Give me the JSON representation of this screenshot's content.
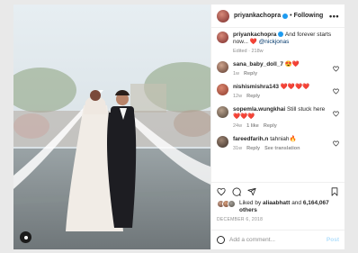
{
  "header": {
    "username": "priyankachopra",
    "separator": "•",
    "follow_label": "Following",
    "more_icon": "more-horizontal-icon",
    "more_glyph": "•••"
  },
  "caption": {
    "username": "priyankachopra",
    "text": "And forever starts now... ❤️",
    "mention": "@nickjonas",
    "edited": "Edited · 218w"
  },
  "comments": [
    {
      "username": "sana_baby_doll_7",
      "text": "😍❤️",
      "age": "1w",
      "likes": "",
      "reply": "Reply",
      "translate": ""
    },
    {
      "username": "nishismishra143",
      "text": "❤️❤️❤️❤️",
      "age": "12w",
      "likes": "",
      "reply": "Reply",
      "translate": ""
    },
    {
      "username": "sopemla.wungkhai",
      "text": "Still stuck here ❤️❤️❤️",
      "age": "24w",
      "likes": "1 like",
      "reply": "Reply",
      "translate": ""
    },
    {
      "username": "fareedfarih.n",
      "text": "tahniah🔥",
      "age": "31w",
      "likes": "",
      "reply": "Reply",
      "translate": "See translation"
    }
  ],
  "likes": {
    "prefix": "Liked by",
    "user": "aliaabhatt",
    "and": "and",
    "count": "6,164,067 others"
  },
  "post_date": "DECEMBER 6, 2018",
  "add_comment": {
    "placeholder": "Add a comment...",
    "post_label": "Post"
  },
  "colors": {
    "accent": "#0095f6",
    "post_disabled": "#b2dffc",
    "verified": "#1d9bf0",
    "heart": "#ed4956"
  }
}
